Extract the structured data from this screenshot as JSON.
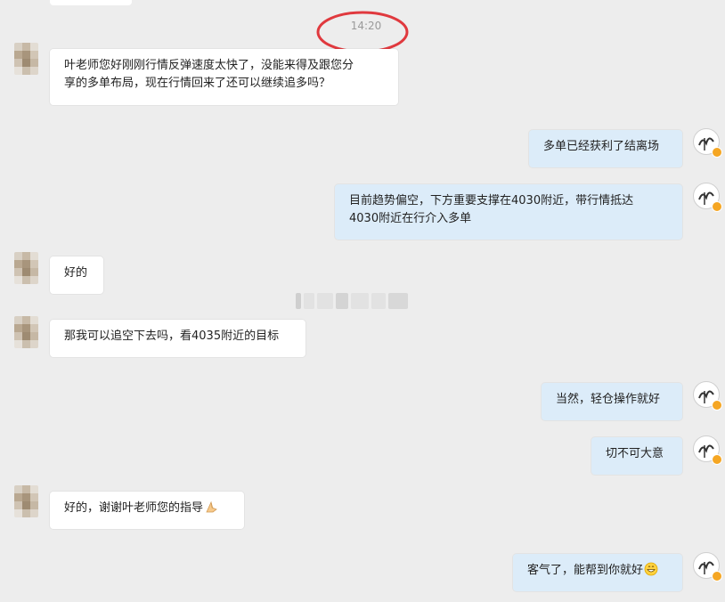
{
  "timestamp": "14:20",
  "messages": [
    {
      "side": "in",
      "text_line1": "叶老师您好刚刚行情反弹速度太快了，没能来得及跟您分",
      "text_line2": "享的多单布局，现在行情回来了还可以继续追多吗？"
    },
    {
      "side": "out",
      "text": "多单已经获利了结离场"
    },
    {
      "side": "out",
      "text_line1": "目前趋势偏空，下方重要支撑在4030附近，带行情抵达",
      "text_line2": "4030附近在行介入多单"
    },
    {
      "side": "in",
      "text": "好的"
    },
    {
      "side": "in",
      "text": "那我可以追空下去吗，看4035附近的目标"
    },
    {
      "side": "out",
      "text": "当然，轻仓操作就好"
    },
    {
      "side": "out",
      "text": "切不可大意"
    },
    {
      "side": "in",
      "text": "好的，谢谢叶老师您的指导",
      "emoji": "folded-hands-emoji"
    },
    {
      "side": "out",
      "text": "客气了，能帮到你就好",
      "emoji": "grinning-face-emoji"
    }
  ],
  "colors": {
    "background": "#ededed",
    "incoming_bubble": "#ffffff",
    "outgoing_bubble": "#dcecf9",
    "annotation_circle": "#e0393e",
    "verified_badge": "#f5a623"
  },
  "icons": {
    "contact_avatar": "pixelated-avatar",
    "teacher_avatar": "calligraphy-avatar-icon",
    "badge": "verified-badge-icon"
  }
}
